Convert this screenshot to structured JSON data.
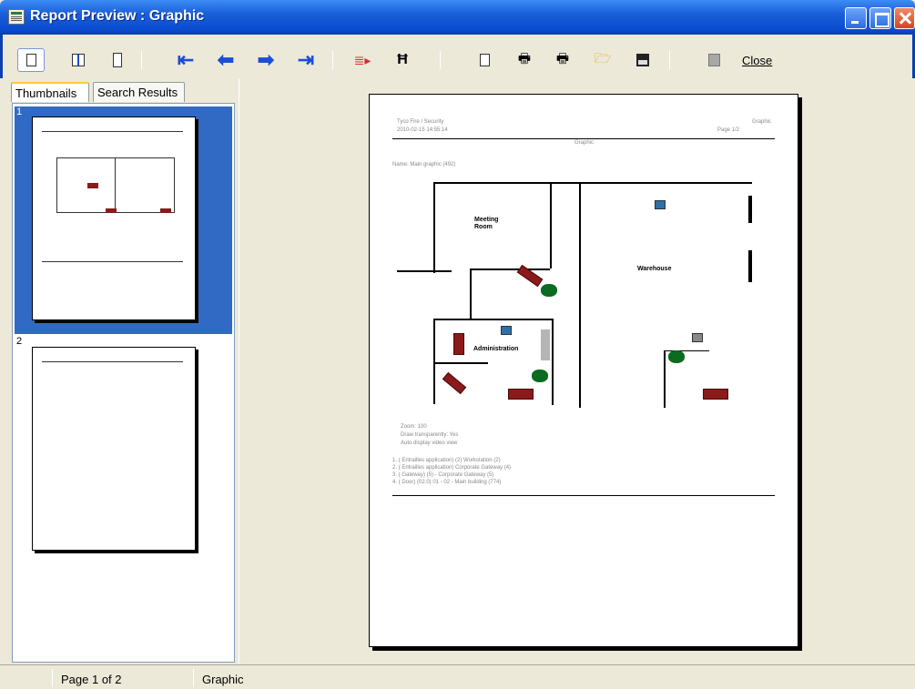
{
  "window": {
    "title": "Report Preview : Graphic"
  },
  "toolbar": {
    "close_label": "Close"
  },
  "tabs": {
    "thumbnails": "Thumbnails",
    "search_results": "Search Results"
  },
  "thumbnails": [
    {
      "number": "1"
    },
    {
      "number": "2"
    }
  ],
  "page": {
    "company": "Tyco Fire / Security",
    "timestamp": "2010-02-15 14:55:14",
    "report_name": "Graphic",
    "page_label": "Page  1/2",
    "center_title": "Graphic",
    "graphic_name": "Name: Main graphic (492)",
    "rooms": {
      "meeting_line1": "Meeting",
      "meeting_line2": "Room",
      "warehouse": "Warehouse",
      "administration": "Administration"
    },
    "props": [
      "Zoom: 100",
      "Draw transparently: Yes",
      "Auto display video view"
    ],
    "items": [
      "1. ( Entrailles application) (2) Workstation (2)",
      "2. ( Entrailles application) Corporate Gateway (4)",
      "3. ( Gateway) (5) - Corporate Gateway (5)",
      "4. ( Door) (02.0) 01 - 02 - Main building (774)"
    ]
  },
  "status": {
    "page_info": "Page 1 of 2",
    "report": "Graphic"
  },
  "colors": {
    "title_bar": "#0A4CD0",
    "selection": "#316AC5",
    "desk": "#8B1A1A",
    "plant": "#0B6B20"
  }
}
